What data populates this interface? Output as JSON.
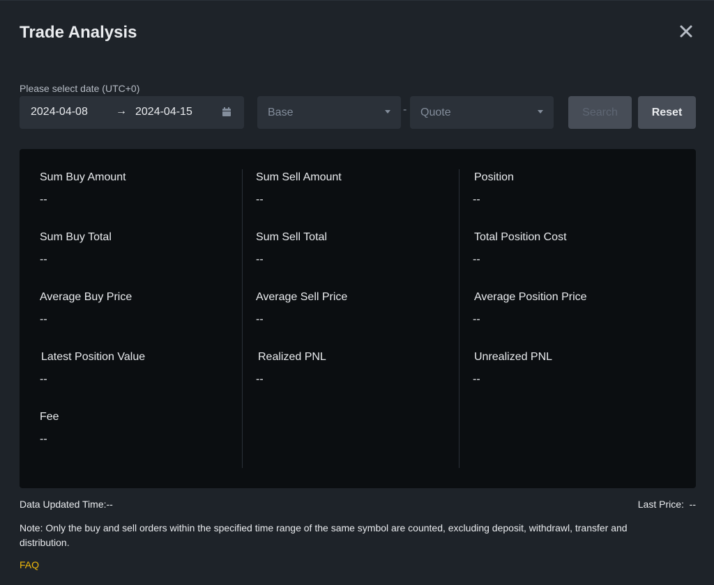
{
  "modal": {
    "title": "Trade Analysis"
  },
  "filters": {
    "date_label": "Please select date (UTC+0)",
    "start_date": "2024-04-08",
    "arrow": "→",
    "end_date": "2024-04-15",
    "base_placeholder": "Base",
    "separator": "-",
    "quote_placeholder": "Quote",
    "search_label": "Search",
    "reset_label": "Reset"
  },
  "stats": {
    "col1": [
      {
        "label": "Sum Buy Amount",
        "value": "--"
      },
      {
        "label": "Sum Buy Total",
        "value": "--"
      },
      {
        "label": "Average Buy Price",
        "value": "--"
      },
      {
        "label": "Latest Position Value",
        "value": "--"
      },
      {
        "label": "Fee",
        "value": "--"
      }
    ],
    "col2": [
      {
        "label": "Sum Sell Amount",
        "value": "--"
      },
      {
        "label": "Sum Sell Total",
        "value": "--"
      },
      {
        "label": "Average Sell Price",
        "value": "--"
      },
      {
        "label": "Realized PNL",
        "value": "--"
      }
    ],
    "col3": [
      {
        "label": "Position",
        "value": "--"
      },
      {
        "label": "Total Position Cost",
        "value": "--"
      },
      {
        "label": "Average Position Price",
        "value": "--"
      },
      {
        "label": "Unrealized PNL",
        "value": "--"
      }
    ]
  },
  "footer": {
    "updated": "Data Updated Time:--",
    "last_price": "Last Price:  --",
    "note": "Note: Only the buy and sell orders within the specified time range of the same symbol are counted, excluding deposit, withdrawl, transfer and distribution.",
    "faq": "FAQ"
  },
  "colors": {
    "accent": "#f0b90b",
    "background": "#1e2329",
    "panel": "#0b0e11",
    "input": "#2b3139"
  },
  "icons": {
    "close": "close-icon",
    "calendar": "calendar-icon",
    "select_caret": "chevron-down-icon",
    "range_arrow": "arrow-right-icon"
  }
}
